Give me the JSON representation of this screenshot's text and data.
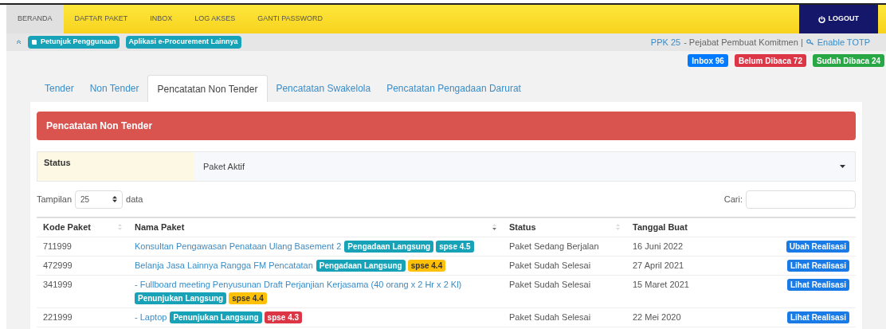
{
  "nav": {
    "items": [
      {
        "label": "BERANDA",
        "selected": true
      },
      {
        "label": "DAFTAR PAKET",
        "selected": false
      },
      {
        "label": "INBOX",
        "selected": false
      },
      {
        "label": "LOG AKSES",
        "selected": false
      },
      {
        "label": "GANTI PASSWORD",
        "selected": false
      }
    ],
    "logout": "LOGOUT"
  },
  "subbar": {
    "links": [
      "Petunjuk Penggunaan",
      "Aplikasi e-Procurement Lainnya"
    ],
    "user_code": "PPK 25",
    "user_role": "- Pejabat Pembuat Komitmen |",
    "totp": "Enable TOTP"
  },
  "badges": [
    {
      "label": "Inbox 96",
      "color": "#007bff"
    },
    {
      "label": "Belum Dibaca 72",
      "color": "#dc3545"
    },
    {
      "label": "Sudah Dibaca 24",
      "color": "#28a745"
    }
  ],
  "tabs": [
    {
      "label": "Tender",
      "selected": false
    },
    {
      "label": "Non Tender",
      "selected": false
    },
    {
      "label": "Pencatatan Non Tender",
      "selected": true
    },
    {
      "label": "Pencatatan Swakelola",
      "selected": false
    },
    {
      "label": "Pencatatan Pengadaan Darurat",
      "selected": false
    }
  ],
  "panel": {
    "title": "Pencatatan Non Tender",
    "filter_label": "Status",
    "filter_value": "Paket Aktif"
  },
  "table_controls": {
    "show_label": "Tampilan",
    "page_size": "25",
    "show_suffix": "data",
    "search_label": "Cari:"
  },
  "table": {
    "columns": [
      "Kode Paket",
      "Nama Paket",
      "Status",
      "Tanggal Buat"
    ],
    "rows": [
      {
        "code": "711999",
        "name": "Konsultan Pengawasan Penataan Ulang Basement 2",
        "tags": [
          {
            "label": "Pengadaan Langsung",
            "color": "#17a2b8"
          },
          {
            "label": "spse 4.5",
            "color": "#17a2b8"
          }
        ],
        "status": "Paket Sedang Berjalan",
        "date": "16 Juni 2022",
        "action": "Ubah Realisasi"
      },
      {
        "code": "472999",
        "name": "Belanja Jasa Lainnya Rangga FM Pencatatan",
        "tags": [
          {
            "label": "Pengadaan Langsung",
            "color": "#17a2b8"
          },
          {
            "label": "spse 4.4",
            "color": "#ffc107"
          }
        ],
        "status": "Paket Sudah Selesai",
        "date": "27 April 2021",
        "action": "Lihat Realisasi"
      },
      {
        "code": "341999",
        "name": "- Fullboard meeting Penyusunan Draft Perjanjian Kerjasama (40 orang x 2 Hr x 2 Kl)",
        "tags": [
          {
            "label": "Penunjukan Langsung",
            "color": "#17a2b8"
          },
          {
            "label": "spse 4.4",
            "color": "#ffc107"
          }
        ],
        "status": "Paket Sudah Selesai",
        "date": "15 Maret 2021",
        "action": "Lihat Realisasi"
      },
      {
        "code": "221999",
        "name": "- Laptop",
        "tags": [
          {
            "label": "Penunjukan Langsung",
            "color": "#17a2b8"
          },
          {
            "label": "spse 4.3",
            "color": "#dc3545"
          }
        ],
        "status": "Paket Sudah Selesai",
        "date": "22 Mei 2020",
        "action": "Lihat Realisasi"
      }
    ]
  }
}
